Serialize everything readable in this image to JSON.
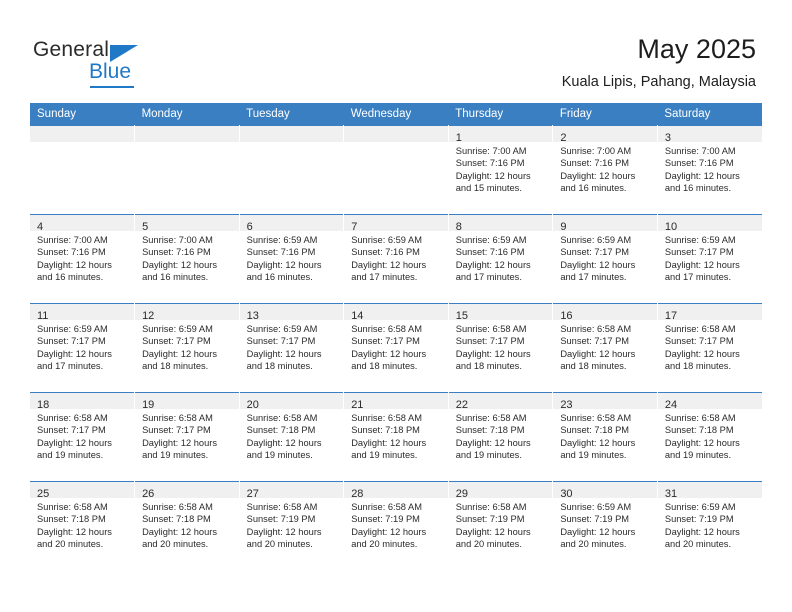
{
  "brand": {
    "name_top": "General",
    "name_bottom": "Blue",
    "accent_color": "#2079c7"
  },
  "header": {
    "title": "May 2025",
    "subtitle": "Kuala Lipis, Pahang, Malaysia"
  },
  "theme": {
    "header_row_bg": "#3a7fc1",
    "header_row_text": "#ffffff",
    "daynum_band_bg": "#f0f0f0",
    "cell_border_top": "#3a7fc1",
    "text_color": "#2b2b2b"
  },
  "weekdays": [
    "Sunday",
    "Monday",
    "Tuesday",
    "Wednesday",
    "Thursday",
    "Friday",
    "Saturday"
  ],
  "labels": {
    "sunrise_prefix": "Sunrise: ",
    "sunset_prefix": "Sunset: ",
    "daylight_prefix": "Daylight: "
  },
  "weeks": [
    [
      {
        "day": "",
        "empty": true
      },
      {
        "day": "",
        "empty": true
      },
      {
        "day": "",
        "empty": true
      },
      {
        "day": "",
        "empty": true
      },
      {
        "day": "1",
        "sunrise": "Sunrise: 7:00 AM",
        "sunset": "Sunset: 7:16 PM",
        "daylight_l1": "Daylight: 12 hours",
        "daylight_l2": "and 15 minutes."
      },
      {
        "day": "2",
        "sunrise": "Sunrise: 7:00 AM",
        "sunset": "Sunset: 7:16 PM",
        "daylight_l1": "Daylight: 12 hours",
        "daylight_l2": "and 16 minutes."
      },
      {
        "day": "3",
        "sunrise": "Sunrise: 7:00 AM",
        "sunset": "Sunset: 7:16 PM",
        "daylight_l1": "Daylight: 12 hours",
        "daylight_l2": "and 16 minutes."
      }
    ],
    [
      {
        "day": "4",
        "sunrise": "Sunrise: 7:00 AM",
        "sunset": "Sunset: 7:16 PM",
        "daylight_l1": "Daylight: 12 hours",
        "daylight_l2": "and 16 minutes."
      },
      {
        "day": "5",
        "sunrise": "Sunrise: 7:00 AM",
        "sunset": "Sunset: 7:16 PM",
        "daylight_l1": "Daylight: 12 hours",
        "daylight_l2": "and 16 minutes."
      },
      {
        "day": "6",
        "sunrise": "Sunrise: 6:59 AM",
        "sunset": "Sunset: 7:16 PM",
        "daylight_l1": "Daylight: 12 hours",
        "daylight_l2": "and 16 minutes."
      },
      {
        "day": "7",
        "sunrise": "Sunrise: 6:59 AM",
        "sunset": "Sunset: 7:16 PM",
        "daylight_l1": "Daylight: 12 hours",
        "daylight_l2": "and 17 minutes."
      },
      {
        "day": "8",
        "sunrise": "Sunrise: 6:59 AM",
        "sunset": "Sunset: 7:16 PM",
        "daylight_l1": "Daylight: 12 hours",
        "daylight_l2": "and 17 minutes."
      },
      {
        "day": "9",
        "sunrise": "Sunrise: 6:59 AM",
        "sunset": "Sunset: 7:17 PM",
        "daylight_l1": "Daylight: 12 hours",
        "daylight_l2": "and 17 minutes."
      },
      {
        "day": "10",
        "sunrise": "Sunrise: 6:59 AM",
        "sunset": "Sunset: 7:17 PM",
        "daylight_l1": "Daylight: 12 hours",
        "daylight_l2": "and 17 minutes."
      }
    ],
    [
      {
        "day": "11",
        "sunrise": "Sunrise: 6:59 AM",
        "sunset": "Sunset: 7:17 PM",
        "daylight_l1": "Daylight: 12 hours",
        "daylight_l2": "and 17 minutes."
      },
      {
        "day": "12",
        "sunrise": "Sunrise: 6:59 AM",
        "sunset": "Sunset: 7:17 PM",
        "daylight_l1": "Daylight: 12 hours",
        "daylight_l2": "and 18 minutes."
      },
      {
        "day": "13",
        "sunrise": "Sunrise: 6:59 AM",
        "sunset": "Sunset: 7:17 PM",
        "daylight_l1": "Daylight: 12 hours",
        "daylight_l2": "and 18 minutes."
      },
      {
        "day": "14",
        "sunrise": "Sunrise: 6:58 AM",
        "sunset": "Sunset: 7:17 PM",
        "daylight_l1": "Daylight: 12 hours",
        "daylight_l2": "and 18 minutes."
      },
      {
        "day": "15",
        "sunrise": "Sunrise: 6:58 AM",
        "sunset": "Sunset: 7:17 PM",
        "daylight_l1": "Daylight: 12 hours",
        "daylight_l2": "and 18 minutes."
      },
      {
        "day": "16",
        "sunrise": "Sunrise: 6:58 AM",
        "sunset": "Sunset: 7:17 PM",
        "daylight_l1": "Daylight: 12 hours",
        "daylight_l2": "and 18 minutes."
      },
      {
        "day": "17",
        "sunrise": "Sunrise: 6:58 AM",
        "sunset": "Sunset: 7:17 PM",
        "daylight_l1": "Daylight: 12 hours",
        "daylight_l2": "and 18 minutes."
      }
    ],
    [
      {
        "day": "18",
        "sunrise": "Sunrise: 6:58 AM",
        "sunset": "Sunset: 7:17 PM",
        "daylight_l1": "Daylight: 12 hours",
        "daylight_l2": "and 19 minutes."
      },
      {
        "day": "19",
        "sunrise": "Sunrise: 6:58 AM",
        "sunset": "Sunset: 7:17 PM",
        "daylight_l1": "Daylight: 12 hours",
        "daylight_l2": "and 19 minutes."
      },
      {
        "day": "20",
        "sunrise": "Sunrise: 6:58 AM",
        "sunset": "Sunset: 7:18 PM",
        "daylight_l1": "Daylight: 12 hours",
        "daylight_l2": "and 19 minutes."
      },
      {
        "day": "21",
        "sunrise": "Sunrise: 6:58 AM",
        "sunset": "Sunset: 7:18 PM",
        "daylight_l1": "Daylight: 12 hours",
        "daylight_l2": "and 19 minutes."
      },
      {
        "day": "22",
        "sunrise": "Sunrise: 6:58 AM",
        "sunset": "Sunset: 7:18 PM",
        "daylight_l1": "Daylight: 12 hours",
        "daylight_l2": "and 19 minutes."
      },
      {
        "day": "23",
        "sunrise": "Sunrise: 6:58 AM",
        "sunset": "Sunset: 7:18 PM",
        "daylight_l1": "Daylight: 12 hours",
        "daylight_l2": "and 19 minutes."
      },
      {
        "day": "24",
        "sunrise": "Sunrise: 6:58 AM",
        "sunset": "Sunset: 7:18 PM",
        "daylight_l1": "Daylight: 12 hours",
        "daylight_l2": "and 19 minutes."
      }
    ],
    [
      {
        "day": "25",
        "sunrise": "Sunrise: 6:58 AM",
        "sunset": "Sunset: 7:18 PM",
        "daylight_l1": "Daylight: 12 hours",
        "daylight_l2": "and 20 minutes."
      },
      {
        "day": "26",
        "sunrise": "Sunrise: 6:58 AM",
        "sunset": "Sunset: 7:18 PM",
        "daylight_l1": "Daylight: 12 hours",
        "daylight_l2": "and 20 minutes."
      },
      {
        "day": "27",
        "sunrise": "Sunrise: 6:58 AM",
        "sunset": "Sunset: 7:19 PM",
        "daylight_l1": "Daylight: 12 hours",
        "daylight_l2": "and 20 minutes."
      },
      {
        "day": "28",
        "sunrise": "Sunrise: 6:58 AM",
        "sunset": "Sunset: 7:19 PM",
        "daylight_l1": "Daylight: 12 hours",
        "daylight_l2": "and 20 minutes."
      },
      {
        "day": "29",
        "sunrise": "Sunrise: 6:58 AM",
        "sunset": "Sunset: 7:19 PM",
        "daylight_l1": "Daylight: 12 hours",
        "daylight_l2": "and 20 minutes."
      },
      {
        "day": "30",
        "sunrise": "Sunrise: 6:59 AM",
        "sunset": "Sunset: 7:19 PM",
        "daylight_l1": "Daylight: 12 hours",
        "daylight_l2": "and 20 minutes."
      },
      {
        "day": "31",
        "sunrise": "Sunrise: 6:59 AM",
        "sunset": "Sunset: 7:19 PM",
        "daylight_l1": "Daylight: 12 hours",
        "daylight_l2": "and 20 minutes."
      }
    ]
  ]
}
